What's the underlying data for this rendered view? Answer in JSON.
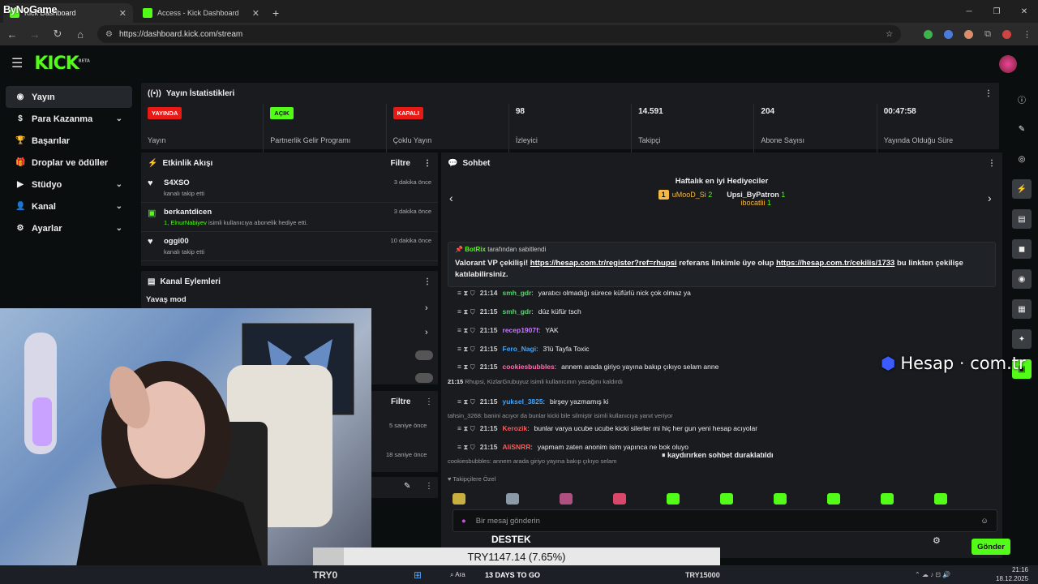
{
  "browser": {
    "overlay_brand": "ByNoGame",
    "tabs": [
      {
        "label": "Kick Dashboard"
      },
      {
        "label": "Access - Kick Dashboard"
      }
    ],
    "url": "https://dashboard.kick.com/stream"
  },
  "header": {
    "logo": "KICK",
    "logo_tag": "BETA"
  },
  "sidebar": {
    "items": [
      {
        "label": "Yayın",
        "icon": "broadcast-icon",
        "selected": true
      },
      {
        "label": "Para Kazanma",
        "icon": "dollar-icon",
        "expandable": true
      },
      {
        "label": "Başarılar",
        "icon": "trophy-icon"
      },
      {
        "label": "Droplar ve ödüller",
        "icon": "gift-icon"
      },
      {
        "label": "Stüdyo",
        "icon": "video-icon",
        "expandable": true
      },
      {
        "label": "Kanal",
        "icon": "user-icon",
        "expandable": true
      },
      {
        "label": "Ayarlar",
        "icon": "gear-icon",
        "expandable": true
      }
    ]
  },
  "stats": {
    "title": "Yayın İstatistikleri",
    "cards": [
      {
        "badge": "YAYINDA",
        "badge_color": "#e91916",
        "label": "Yayın"
      },
      {
        "badge": "AÇIK",
        "badge_color": "#53fc18",
        "label": "Partnerlik Gelir Programı"
      },
      {
        "badge": "KAPALI",
        "badge_color": "#e91916",
        "label": "Çoklu Yayın"
      },
      {
        "value": "98",
        "label": "İzleyici"
      },
      {
        "value": "14.591",
        "label": "Takipçi"
      },
      {
        "value": "204",
        "label": "Abone Sayısı"
      },
      {
        "value": "00:47:58",
        "label": "Yayında Olduğu Süre"
      }
    ]
  },
  "activity": {
    "title": "Etkinlik Akışı",
    "filter": "Filtre",
    "items": [
      {
        "name": "S4XSO",
        "desc": "kanalı takip etti",
        "time": "3 dakika önce",
        "icon": "heart-icon"
      },
      {
        "name": "berkantdicen",
        "desc_highlight": "1, ElnurNabiyev",
        "desc": "isimli kullanıcıya abonelik hediye etti.",
        "time": "3 dakika önce",
        "icon": "gift-sub-icon"
      },
      {
        "name": "oggi00",
        "desc": "kanalı takip etti",
        "time": "10 dakika önce",
        "icon": "heart-icon"
      }
    ]
  },
  "channel_actions": {
    "title": "Kanal Eylemleri",
    "slow_mode": "Yavaş mod",
    "filter": "Filtre",
    "times": [
      "5 saniye önce",
      "18 saniye önce"
    ]
  },
  "chat": {
    "title": "Sohbet",
    "gifters_title": "Haftalık en iyi Hediyeciler",
    "gifters": [
      {
        "name": "uMooD_Si",
        "count": "2",
        "rank": "1"
      },
      {
        "name": "Upsi_ByPatron",
        "count": "1"
      },
      {
        "name": "ibocatlii",
        "count": "1"
      }
    ],
    "pinned": {
      "by": "BotRix",
      "by_suffix": "tarafından sabitlendi",
      "text_a": "Valorant VP çekilişi!",
      "link_1": "https://hesap.com.tr/register?ref=rhupsi",
      "text_b": "referans linkimle üye olup",
      "link_2": "https://hesap.com.tr/cekilis/1733",
      "text_c": "bu linkten çekilişe katılabilirsiniz."
    },
    "messages": [
      {
        "time": "21:14",
        "user": "smh_gdr",
        "color": "#53d769",
        "text": "yaratıcı olmadığı sürece küfürlü nick çok olmaz ya"
      },
      {
        "time": "21:15",
        "user": "smh_gdr",
        "color": "#53d769",
        "text": "düz küfür tsch"
      },
      {
        "time": "21:15",
        "user": "recep1907f",
        "color": "#c879ff",
        "text": "YAK"
      },
      {
        "time": "21:15",
        "user": "Fero_Nagi",
        "color": "#3ea6ff",
        "text": "3'lü Tayfa Toxic"
      },
      {
        "time": "21:15",
        "user": "cookiesbubbles",
        "color": "#ff6fb0",
        "text": "annem arada giriyo yayına bakıp çıkıyo selam anne"
      },
      {
        "time": "21:15",
        "user": "yuksel_3825",
        "color": "#3ea6ff",
        "text": "birşey yazmamış ki"
      },
      {
        "time": "21:15",
        "user": "Kerozik",
        "color": "#ff5a5a",
        "text": "bunlar varya ucube ucube kicki silerler mi hiç her gun yeni hesap acıyolar"
      },
      {
        "time": "21:15",
        "user": "AliSNRR",
        "color": "#ff5a5a",
        "text": "yapmam zaten anonim isim yapınca ne bok oluyo"
      }
    ],
    "system": {
      "time": "21:15",
      "actors": "Rhupsi, KizlarGrubuyuz",
      "text": "isimli kullanıcının yasağını kaldırdı"
    },
    "reply_1": "tahsin_3268: banini acıyor da bunlar kicki bile silmiştir isimli kullanıcıya yanıt veriyor",
    "reply_2": "cookiesbubbles: annem arada giriyo yayına bakıp çıkıyo selam",
    "paused": "kaydırırken sohbet duraklatıldı",
    "followers_label": "Takipçilere Özel",
    "input_placeholder": "Bir mesaj gönderin",
    "send": "Gönder"
  },
  "overlays": {
    "hesap": "Hesap",
    "hesap_suffix": "com.tr",
    "ticker": "TRY1147.14 (7.65%)",
    "ticker_left": "TRY0",
    "destek": "DESTEK",
    "days": "13 DAYS TO GO",
    "try_right": "TRY15000"
  },
  "taskbar": {
    "search": "Ara",
    "time": "21:16",
    "date": "18.12.2025"
  }
}
